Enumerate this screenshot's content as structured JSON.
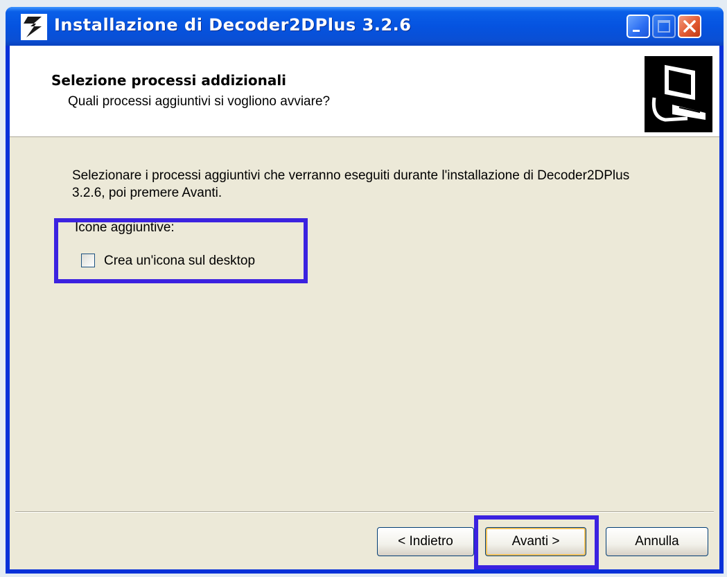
{
  "window": {
    "title": "Installazione di Decoder2DPlus 3.2.6"
  },
  "header": {
    "title": "Selezione processi addizionali",
    "subtitle": "Quali processi aggiuntivi si vogliono avviare?"
  },
  "body": {
    "description": "Selezionare i processi aggiuntivi che verranno eseguiti durante l'installazione di Decoder2DPlus 3.2.6, poi premere Avanti.",
    "group_label": "Icone aggiuntive:",
    "checkbox_label": "Crea un'icona sul desktop",
    "checkbox_checked": false
  },
  "buttons": {
    "back": "< Indietro",
    "next": "Avanti >",
    "cancel": "Annulla"
  },
  "icons": [
    "app-icon",
    "minimize-icon",
    "maximize-icon",
    "close-icon",
    "installer-computer-icon"
  ],
  "colors": {
    "titlebar": "#0553e0",
    "highlight": "#3b22e0",
    "dialog": "#ece9d8",
    "close": "#e25a32"
  }
}
